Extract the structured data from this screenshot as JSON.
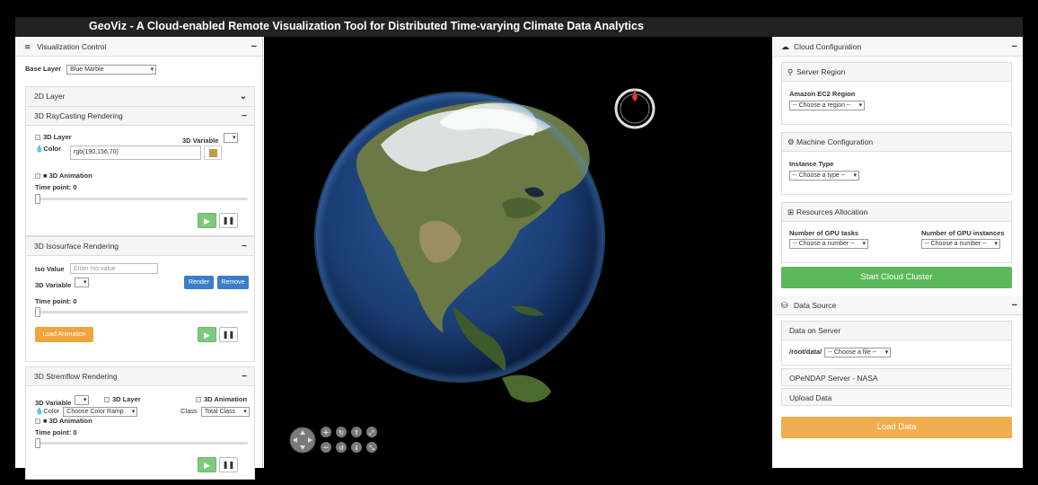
{
  "app": {
    "title": "GeoViz  -  A Cloud-enabled Remote Visualization Tool for Distributed Time-varying Climate Data Analytics"
  },
  "left": {
    "panel_title": "Visualization Control",
    "base_layer_label": "Base Layer",
    "base_layer_value": "Blue Marble",
    "layer2d_title": "2D Layer",
    "raycast": {
      "title": "3D RayCasting Rendering",
      "layer3d_label": "3D Layer",
      "variable_label": "3D Variable",
      "color_label": "Color",
      "color_value": "rgb(190,156,70)",
      "color_swatch": "#be9c46",
      "animation_label": "3D Animation",
      "timepoint_label": "Time point: 0"
    },
    "iso": {
      "title": "3D Isosurface Rendering",
      "iso_label": "Iso Value",
      "iso_placeholder": "Enter Iso value",
      "variable_label": "3D Variable",
      "render_label": "Render",
      "remove_label": "Remove",
      "timepoint_label": "Time point: 0",
      "load_animation_label": "Load Animation"
    },
    "stream": {
      "title": "3D Stremflow Rendering",
      "variable_label": "3D Variable",
      "layer3d_label": "3D Layer",
      "animation_label": "3D Animation",
      "color_label": "Color",
      "color_ramp_value": "Choose Color Ramp",
      "class_label": "Class",
      "class_value": "Total Class",
      "animation2_label": "3D Animation",
      "timepoint_label": "Time point: 0"
    }
  },
  "right": {
    "panel_title": "Cloud Configuration",
    "region": {
      "title": "Server Region",
      "field_label": "Amazon EC2 Region",
      "select_value": "-- Choose a region --"
    },
    "machine": {
      "title": "Machine Configuration",
      "field_label": "Instance Type",
      "select_value": "-- Choose a type --"
    },
    "resources": {
      "title": "Resources Allocation",
      "gpu_tasks_label": "Number of GPU tasks",
      "gpu_tasks_value": "-- Choose a number --",
      "gpu_instances_label": "Number of GPU instances",
      "gpu_instances_value": "-- Choose a number --"
    },
    "start_label": "Start Cloud Cluster",
    "data_source": {
      "title": "Data Source",
      "server_label": "Data on Server",
      "path_label": "/root/data/",
      "file_value": "-- Choose a file --",
      "opendap_label": "OPeNDAP Server - NASA",
      "upload_label": "Upload Data",
      "load_label": "Load Data"
    }
  },
  "colors": {
    "green": "#5cb85c",
    "orange": "#f0ad4e",
    "blue": "#3a7ec6"
  }
}
